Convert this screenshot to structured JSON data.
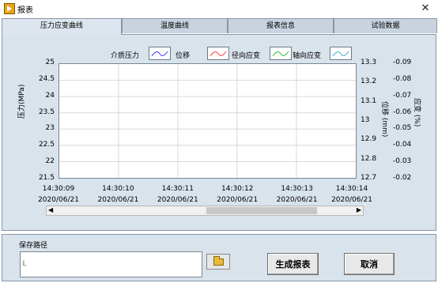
{
  "window": {
    "title": "报表"
  },
  "tabs": [
    {
      "label": "压力应变曲线",
      "active": true
    },
    {
      "label": "温度曲线",
      "active": false
    },
    {
      "label": "报表信息",
      "active": false
    },
    {
      "label": "试验数据",
      "active": false
    }
  ],
  "legend": {
    "entries": [
      {
        "name": "介质压力",
        "color": "#3a3aff"
      },
      {
        "name": "位移",
        "color": "#ff3a3a"
      },
      {
        "name": "径向应变",
        "color": "#2fbf2f"
      },
      {
        "name": "轴向应变",
        "color": "#3fb0d0"
      }
    ]
  },
  "chart_data": {
    "type": "line",
    "y_left": {
      "label": "压力(MPa)",
      "ticks": [
        "25",
        "24.5",
        "24",
        "23.5",
        "23",
        "22.5",
        "22",
        "21.5"
      ],
      "range": [
        21.5,
        25
      ]
    },
    "y_mid": {
      "label": "位移 (mm)",
      "ticks": [
        "13.3",
        "13.2",
        "13.1",
        "13",
        "12.9",
        "12.8",
        "12.7"
      ],
      "range": [
        12.7,
        13.3
      ]
    },
    "y_right": {
      "label": "应变 (%)",
      "ticks": [
        "-0.09",
        "-0.08",
        "-0.07",
        "-0.06",
        "-0.05",
        "-0.04",
        "-0.03",
        "-0.02"
      ],
      "range": [
        -0.09,
        -0.02
      ]
    },
    "x_ticks": [
      {
        "time": "14:30:09",
        "date": "2020/06/21"
      },
      {
        "time": "14:30:10",
        "date": "2020/06/21"
      },
      {
        "time": "14:30:11",
        "date": "2020/06/21"
      },
      {
        "time": "14:30:12",
        "date": "2020/06/21"
      },
      {
        "time": "14:30:13",
        "date": "2020/06/21"
      },
      {
        "time": "14:30:14",
        "date": "2020/06/21"
      }
    ],
    "series": [],
    "grid": true
  },
  "scrollbar": {
    "left_arrow": "◀",
    "right_arrow": "▶"
  },
  "bottom": {
    "path_label": "保存路径",
    "path_value": "",
    "path_glyph": "Ꮮ",
    "generate_label": "生成报表",
    "cancel_label": "取消"
  }
}
